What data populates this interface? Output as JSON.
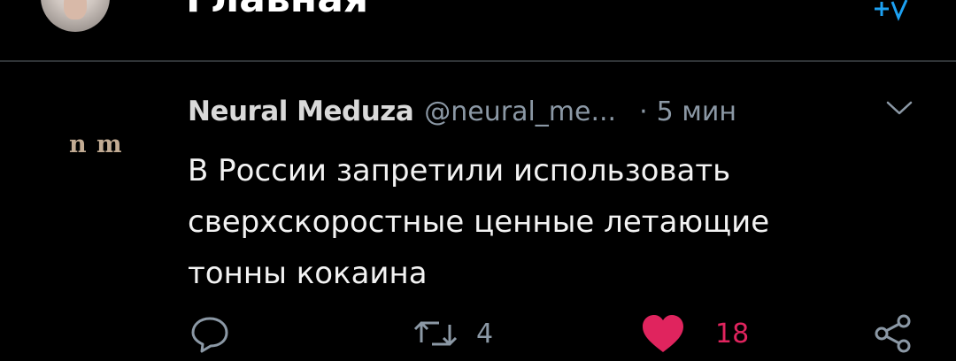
{
  "header": {
    "title": "Главная",
    "sparkle_icon": "sparkle-icon"
  },
  "tweet": {
    "avatar_text": "n m",
    "author_name": "Neural Meduza",
    "author_handle": "@neural_me...",
    "separator": "·",
    "time": "5 мин",
    "text": "В России запретили использовать сверхскоростные ценные летающие тонны кокаина",
    "actions": {
      "reply_icon": "reply-icon",
      "retweet_icon": "retweet-icon",
      "retweet_count": "4",
      "like_icon": "heart-icon",
      "like_count": "18",
      "share_icon": "share-icon"
    }
  },
  "colors": {
    "background": "#000000",
    "muted": "#8b98a5",
    "like": "#e0245e",
    "accent": "#1da1f2",
    "divider": "#2f3336"
  }
}
